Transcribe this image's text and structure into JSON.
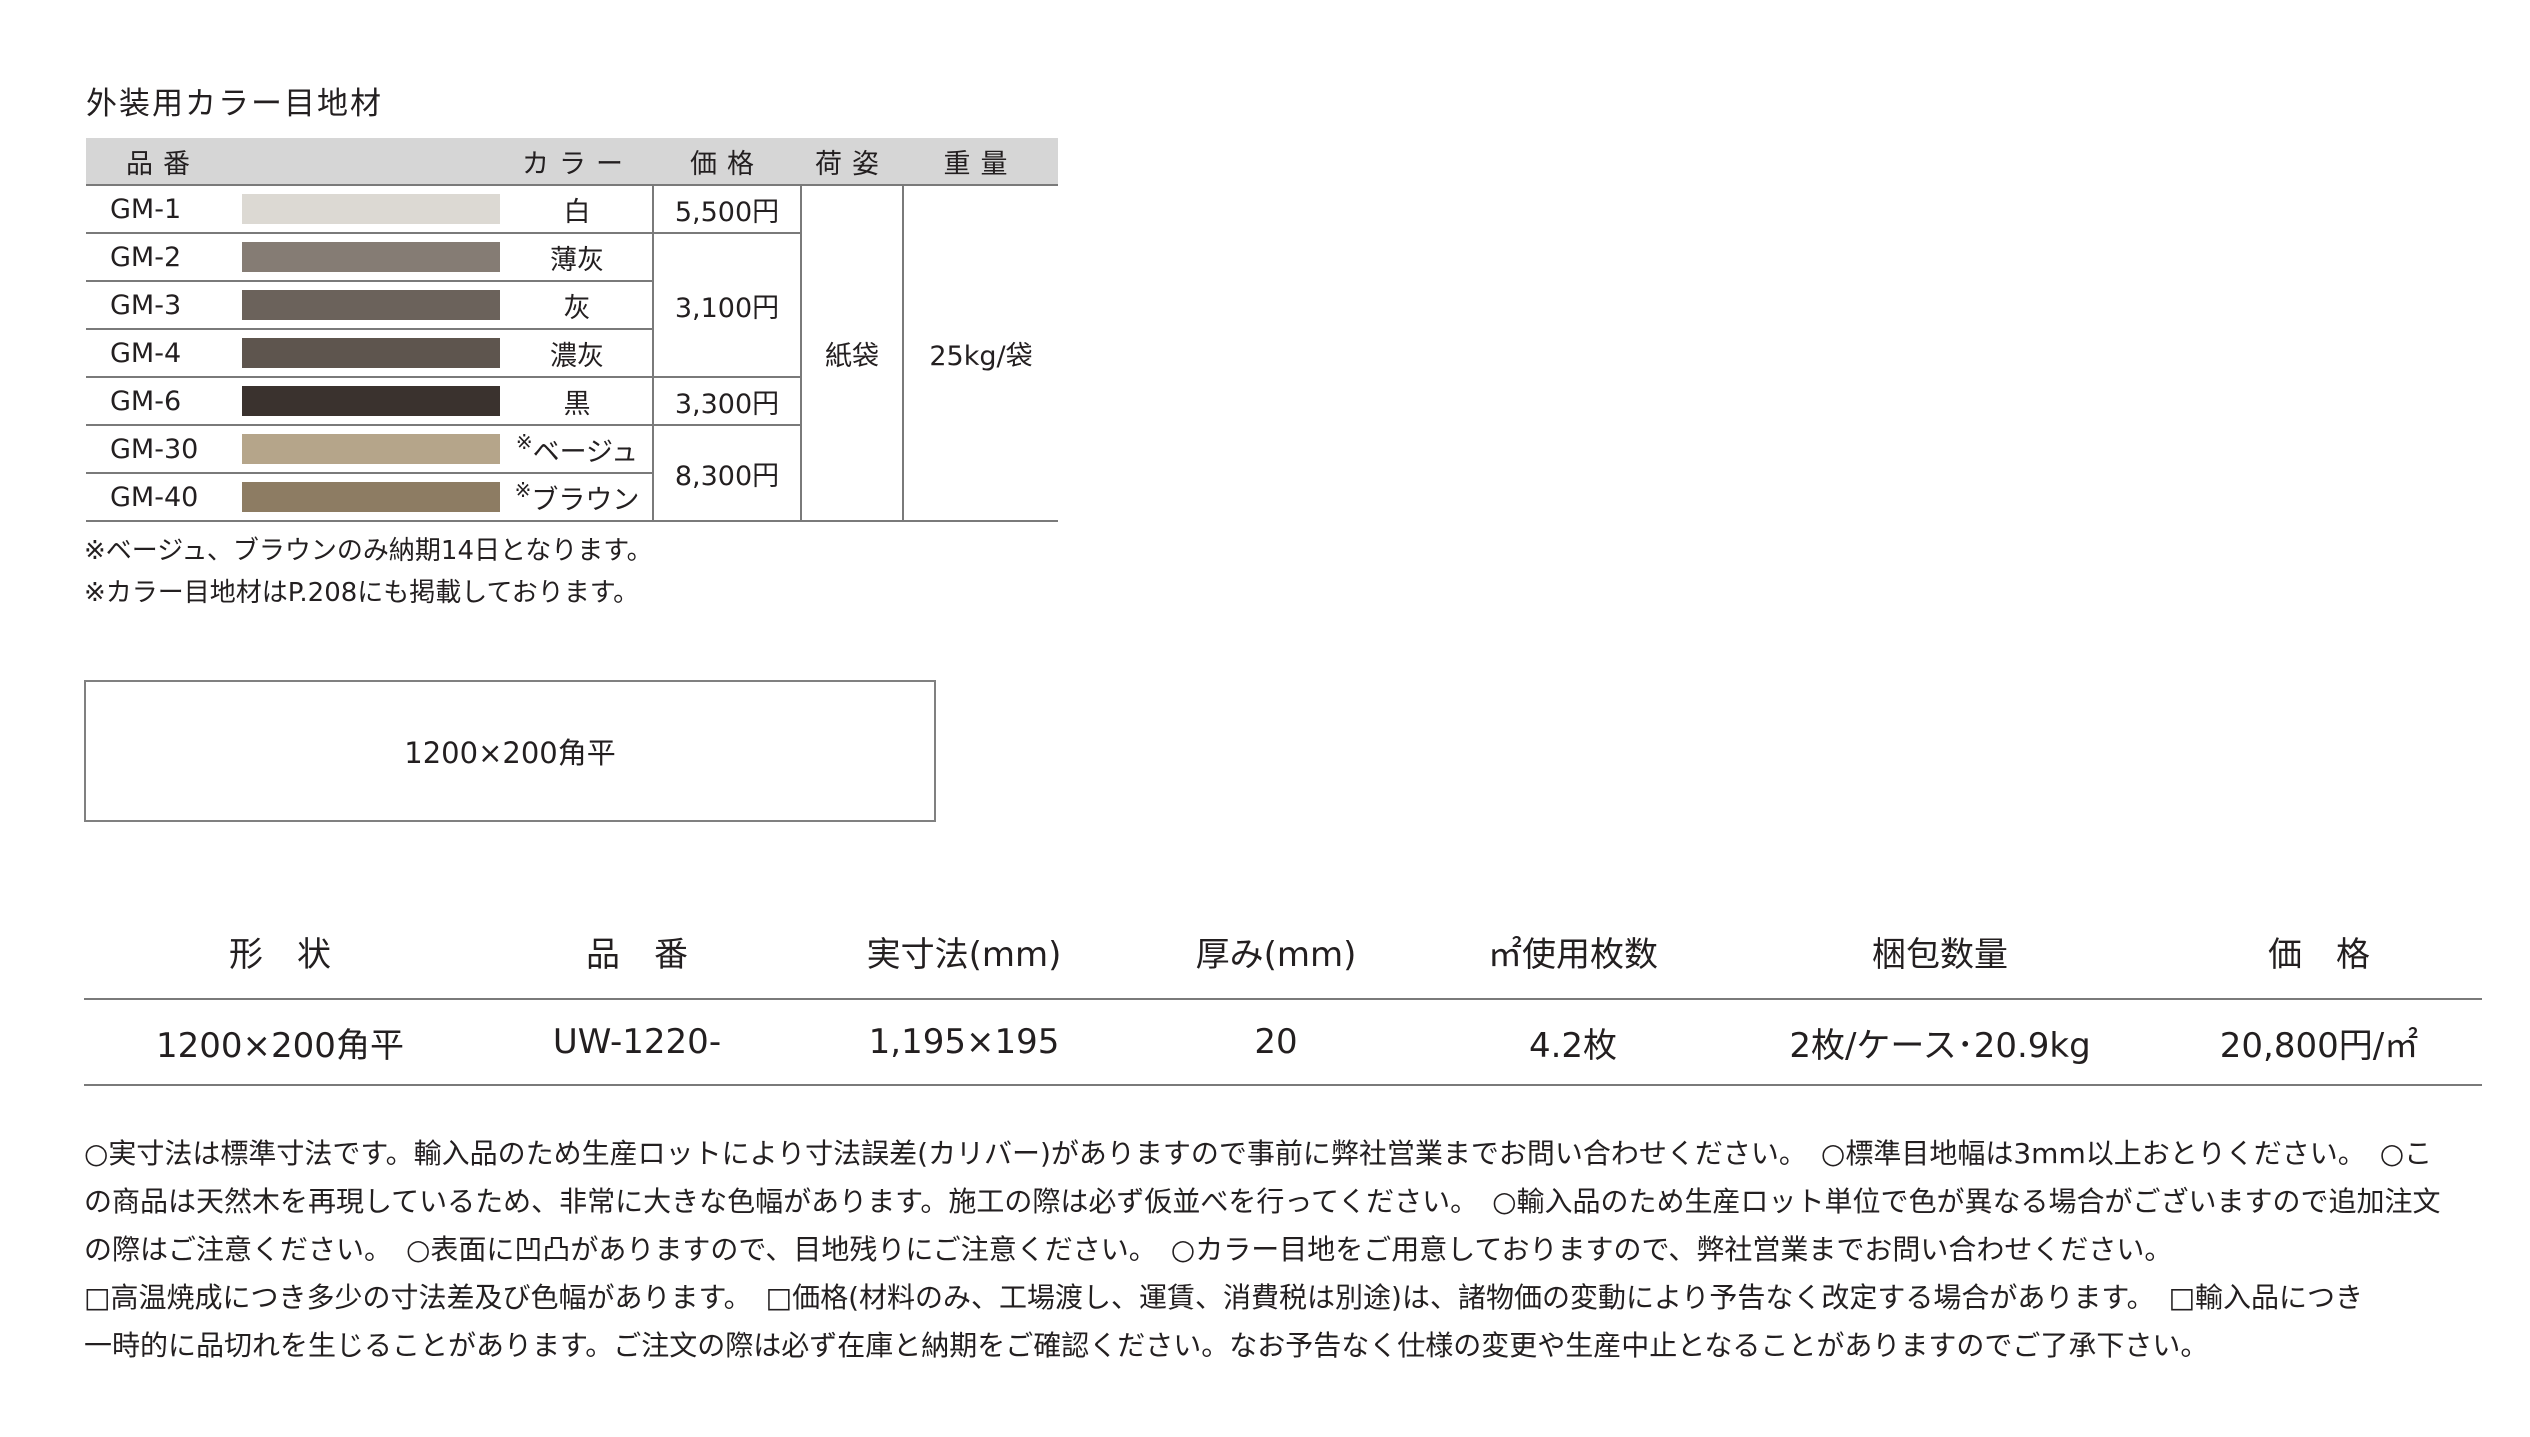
{
  "title": "外装用カラー目地材",
  "grout_table": {
    "headers": {
      "code": "品番",
      "color": "カラー",
      "price": "価格",
      "packing": "荷姿",
      "weight": "重量"
    },
    "rows": [
      {
        "code": "GM-1",
        "color": "白",
        "mark": "",
        "swatch": "#dcd9d3"
      },
      {
        "code": "GM-2",
        "color": "薄灰",
        "mark": "",
        "swatch": "#857c74"
      },
      {
        "code": "GM-3",
        "color": "灰",
        "mark": "",
        "swatch": "#6b625b"
      },
      {
        "code": "GM-4",
        "color": "濃灰",
        "mark": "",
        "swatch": "#5e554e"
      },
      {
        "code": "GM-6",
        "color": "黒",
        "mark": "",
        "swatch": "#3a322e"
      },
      {
        "code": "GM-30",
        "color": "ベージュ",
        "mark": "※",
        "swatch": "#b5a58a"
      },
      {
        "code": "GM-40",
        "color": "ブラウン",
        "mark": "※",
        "swatch": "#8d7c63"
      }
    ],
    "prices": [
      "5,500円",
      "3,100円",
      "3,300円",
      "8,300円"
    ],
    "packing": "紙袋",
    "weight": "25kg/袋"
  },
  "notes": [
    "※ベージュ、ブラウンのみ納期14日となります。",
    "※カラー目地材はP.208にも掲載しております。"
  ],
  "shape_label": "1200×200角平",
  "spec": {
    "headers": [
      "形　状",
      "品　番",
      "実寸法(mm)",
      "厚み(mm)",
      "㎡使用枚数",
      "梱包数量",
      "価　格"
    ],
    "row": [
      "1200×200角平",
      "UW-1220-",
      "1,195×195",
      "20",
      "4.2枚",
      "2枚/ケース･20.9kg",
      "20,800円/㎡"
    ]
  },
  "footer": [
    "○実寸法は標準寸法です。輸入品のため生産ロットにより寸法誤差(カリバー)がありますので事前に弊社営業までお問い合わせください。　○標準目地幅は3mm以上おとりください。　○こ",
    "の商品は天然木を再現しているため、非常に大きな色幅があります。施工の際は必ず仮並べを行ってください。　○輸入品のため生産ロット単位で色が異なる場合がございますので追加注文",
    "の際はご注意ください。　○表面に凹凸がありますので、目地残りにご注意ください。　○カラー目地をご用意しておりますので、弊社営業までお問い合わせください。",
    "□高温焼成につき多少の寸法差及び色幅があります。　□価格(材料のみ、工場渡し、運賃、消費税は別途)は、諸物価の変動により予告なく改定する場合があります。　□輸入品につき",
    "一時的に品切れを生じることがあります。ご注文の際は必ず在庫と納期をご確認ください。なお予告なく仕様の変更や生産中止となることがありますのでご了承下さい。"
  ]
}
